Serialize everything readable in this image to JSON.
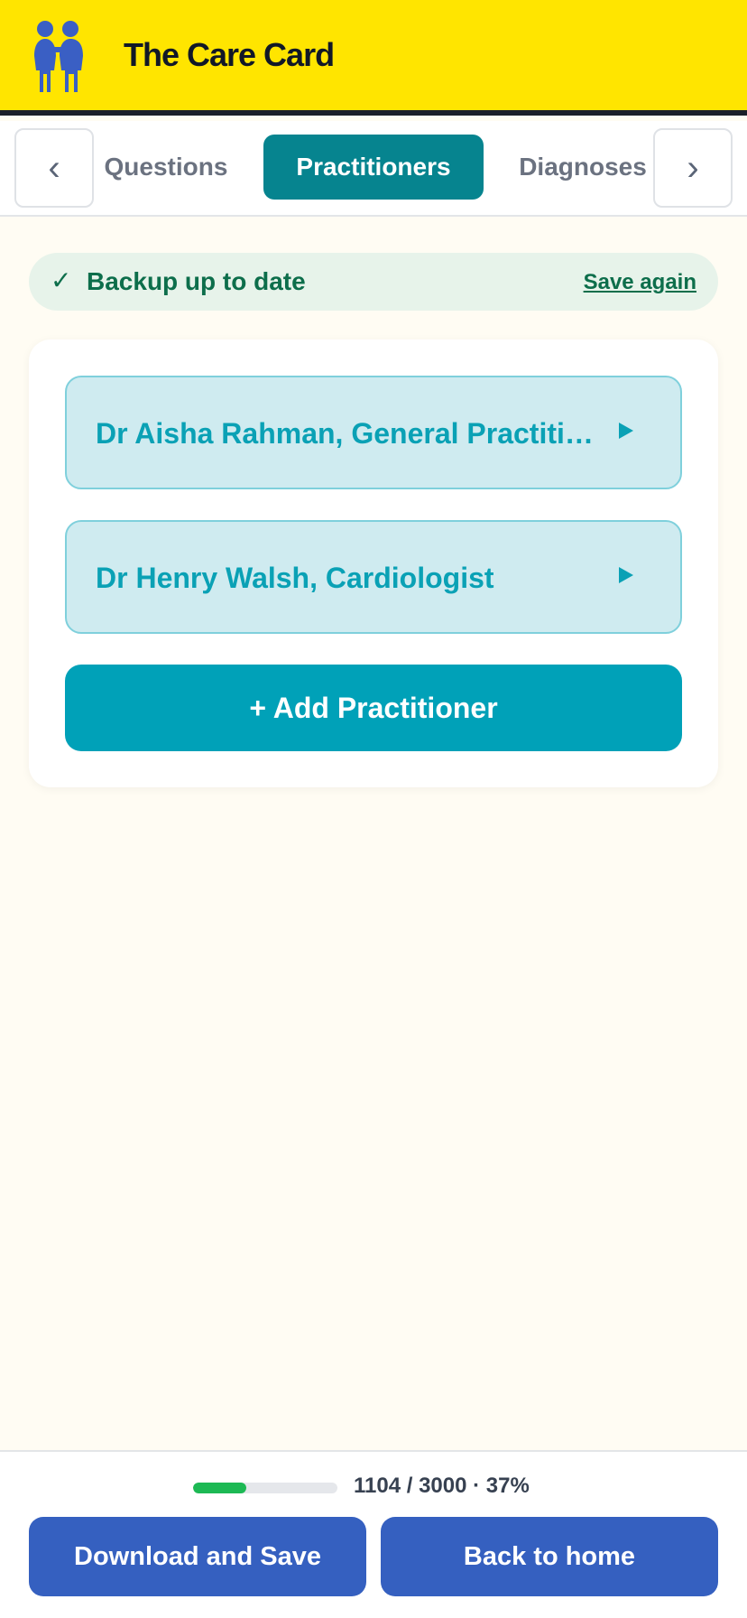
{
  "header": {
    "title": "The Care Card",
    "logo_icon": "two-people-logo-icon",
    "colors": {
      "background": "#ffe500",
      "logo": "#3a5fc4"
    }
  },
  "tabs": {
    "prev_icon": "‹",
    "next_icon": "›",
    "items": [
      {
        "label": "Questions",
        "active": false
      },
      {
        "label": "Practitioners",
        "active": true
      },
      {
        "label": "Diagnoses",
        "active": false
      }
    ]
  },
  "status": {
    "check": "✓",
    "message": "Backup up to date",
    "action": "Save again",
    "color": "#0d6e4b"
  },
  "practitioners": [
    {
      "name": "Dr Aisha Rahman, General Practitioner"
    },
    {
      "name": "Dr Henry Walsh, Cardiologist"
    }
  ],
  "add_button": "+ Add Practitioner",
  "footer": {
    "progress_fraction": 0.37,
    "progress_text": "1104 / 3000 · 37%",
    "download_label": "Download and Save",
    "home_label": "Back to home"
  }
}
